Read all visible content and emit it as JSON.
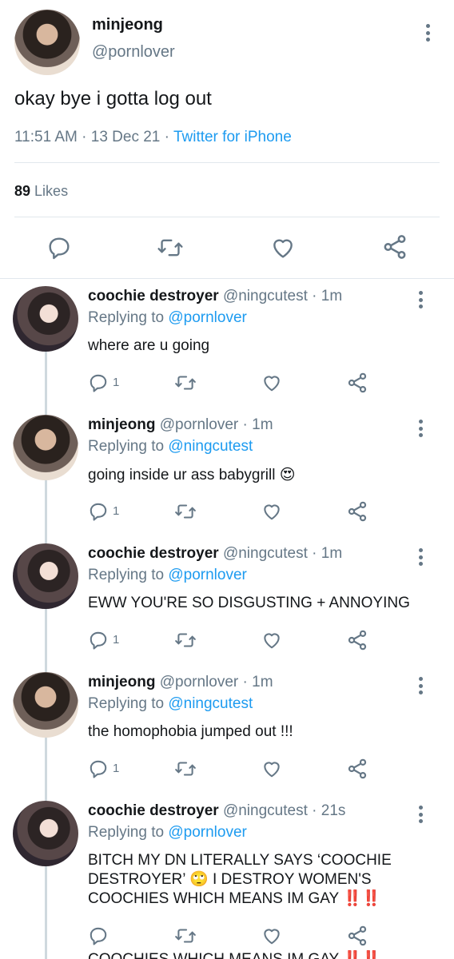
{
  "main_tweet": {
    "display_name": "minjeong",
    "handle": "@pornlover",
    "text": "okay bye i gotta log out",
    "time": "11:51 AM",
    "date": "13 Dec 21",
    "separator": "·",
    "source": "Twitter for iPhone",
    "likes_count": "89",
    "likes_label": "Likes"
  },
  "replies": [
    {
      "display_name": "coochie destroyer",
      "handle": "@ningcutest",
      "meta": "· 1m",
      "replying_label": "Replying to",
      "replying_to": "@pornlover",
      "text": "where are u going",
      "reply_count": "1",
      "avatar": "coochie"
    },
    {
      "display_name": "minjeong",
      "handle": "@pornlover",
      "meta": "· 1m",
      "replying_label": "Replying to",
      "replying_to": "@ningcutest",
      "text": "going inside ur ass babygrill",
      "emoji": "😍",
      "reply_count": "1",
      "avatar": "minjeong"
    },
    {
      "display_name": "coochie destroyer",
      "handle": "@ningcutest",
      "meta": "· 1m",
      "replying_label": "Replying to",
      "replying_to": "@pornlover",
      "text": "EWW YOU'RE SO DISGUSTING + ANNOYING",
      "reply_count": "1",
      "avatar": "coochie"
    },
    {
      "display_name": "minjeong",
      "handle": "@pornlover",
      "meta": "· 1m",
      "replying_label": "Replying to",
      "replying_to": "@ningcutest",
      "text": "the homophobia jumped out !!!",
      "reply_count": "1",
      "avatar": "minjeong"
    },
    {
      "display_name": "coochie destroyer",
      "handle": "@ningcutest",
      "meta": "· 21s",
      "replying_label": "Replying to",
      "replying_to": "@pornlover",
      "line1": "BITCH MY DN LITERALLY SAYS ‘COOCHIE",
      "line2a": "DESTROYER’",
      "emoji2": "🙄",
      "line2b": "I DESTROY WOMEN'S",
      "line3": "COOCHIES WHICH MEANS IM GAY",
      "emoji3": "‼️‼️",
      "avatar": "coochie"
    }
  ],
  "cut_off_text": "COOCHIES WHICH MEANS IM GAY ‼️‼️",
  "icons": {
    "comment": "comment-icon",
    "retweet": "retweet-icon",
    "like": "heart-icon",
    "share": "share-icon",
    "more": "more-vertical-icon"
  },
  "colors": {
    "link": "#1d9bf0",
    "text": "#14171a",
    "muted": "#657786",
    "divider": "#e1e8ed"
  }
}
